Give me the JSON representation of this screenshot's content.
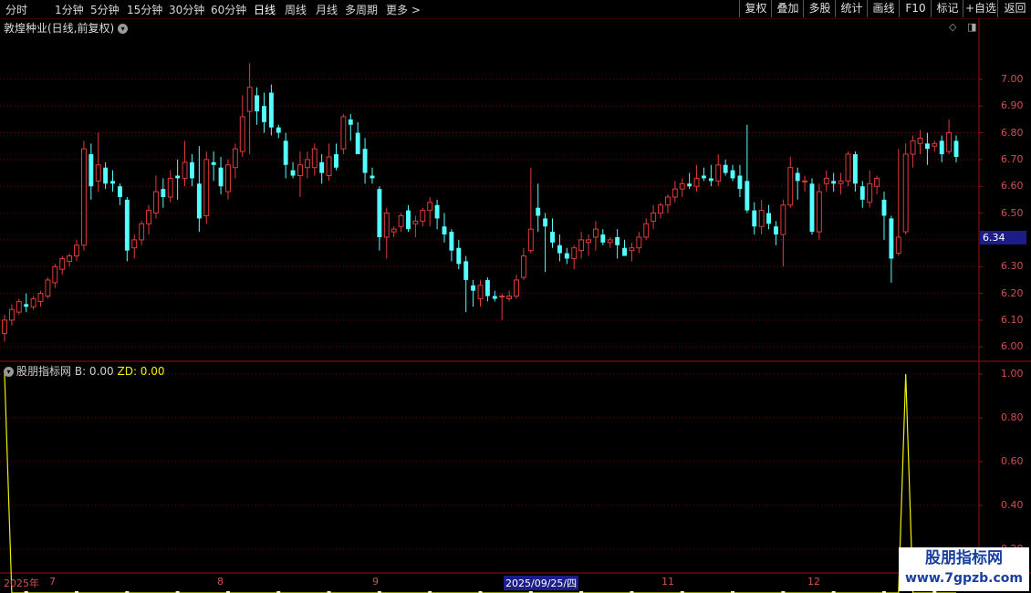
{
  "toolbar": {
    "periods": [
      "分时",
      "1分钟",
      "5分钟",
      "15分钟",
      "30分钟",
      "60分钟",
      "日线",
      "周线",
      "月线",
      "多周期",
      "更多 >"
    ],
    "active": "日线",
    "right_buttons": [
      "复权",
      "叠加",
      "多股",
      "统计",
      "画线",
      "F10",
      "标记",
      "+自选",
      "返回"
    ]
  },
  "main": {
    "title": "敦煌种业(日线,前复权)",
    "current_price": "6.34",
    "y_ticks": [
      "7.00",
      "6.90",
      "6.80",
      "6.70",
      "6.60",
      "6.50",
      "6.40",
      "6.30",
      "6.20",
      "6.10",
      "6.00"
    ]
  },
  "indicator": {
    "name": "股朋指标网",
    "b_label": "B: 0.00",
    "zd_label": "ZD: 0.00",
    "y_ticks": [
      "1.00",
      "0.80",
      "0.60",
      "0.40",
      "0.20"
    ]
  },
  "dates": {
    "labels": [
      "2025年",
      "7",
      "8",
      "9",
      "2025/09/25/四",
      "11",
      "12"
    ],
    "highlight": "2025/09/25/四"
  },
  "watermark": {
    "line1": "股朋指标网",
    "line2": "www.7gpzb.com"
  },
  "colors": {
    "up": "#e03b3b",
    "down": "#54ffff",
    "grid": "#8a0000",
    "zd_line": "#f0f000"
  },
  "chart_data": {
    "type": "candlestick",
    "ylim": [
      5.96,
      7.17
    ],
    "candles": [
      [
        6.05,
        6.12,
        6.02,
        6.1
      ],
      [
        6.1,
        6.16,
        6.08,
        6.14
      ],
      [
        6.13,
        6.18,
        6.12,
        6.17
      ],
      [
        6.16,
        6.2,
        6.13,
        6.15
      ],
      [
        6.15,
        6.19,
        6.14,
        6.18
      ],
      [
        6.17,
        6.21,
        6.15,
        6.2
      ],
      [
        6.19,
        6.26,
        6.18,
        6.25
      ],
      [
        6.24,
        6.31,
        6.22,
        6.3
      ],
      [
        6.29,
        6.34,
        6.27,
        6.33
      ],
      [
        6.32,
        6.35,
        6.3,
        6.34
      ],
      [
        6.34,
        6.4,
        6.32,
        6.38
      ],
      [
        6.38,
        6.77,
        6.36,
        6.74
      ],
      [
        6.72,
        6.76,
        6.55,
        6.6
      ],
      [
        6.62,
        6.8,
        6.58,
        6.68
      ],
      [
        6.67,
        6.69,
        6.59,
        6.61
      ],
      [
        6.62,
        6.66,
        6.58,
        6.61
      ],
      [
        6.6,
        6.61,
        6.53,
        6.56
      ],
      [
        6.55,
        6.56,
        6.32,
        6.36
      ],
      [
        6.37,
        6.42,
        6.33,
        6.4
      ],
      [
        6.4,
        6.47,
        6.38,
        6.46
      ],
      [
        6.46,
        6.53,
        6.42,
        6.51
      ],
      [
        6.5,
        6.64,
        6.48,
        6.58
      ],
      [
        6.59,
        6.63,
        6.52,
        6.56
      ],
      [
        6.56,
        6.66,
        6.54,
        6.63
      ],
      [
        6.64,
        6.7,
        6.55,
        6.63
      ],
      [
        6.63,
        6.77,
        6.6,
        6.69
      ],
      [
        6.69,
        6.72,
        6.6,
        6.63
      ],
      [
        6.61,
        6.75,
        6.43,
        6.48
      ],
      [
        6.49,
        6.73,
        6.46,
        6.7
      ],
      [
        6.69,
        6.73,
        6.62,
        6.68
      ],
      [
        6.67,
        6.71,
        6.57,
        6.6
      ],
      [
        6.58,
        6.7,
        6.55,
        6.68
      ],
      [
        6.67,
        6.76,
        6.63,
        6.74
      ],
      [
        6.73,
        6.94,
        6.71,
        6.86
      ],
      [
        6.88,
        7.06,
        6.72,
        6.97
      ],
      [
        6.94,
        6.97,
        6.83,
        6.88
      ],
      [
        6.9,
        6.95,
        6.8,
        6.84
      ],
      [
        6.95,
        6.98,
        6.79,
        6.82
      ],
      [
        6.82,
        6.83,
        6.78,
        6.8
      ],
      [
        6.77,
        6.8,
        6.63,
        6.68
      ],
      [
        6.66,
        6.69,
        6.63,
        6.64
      ],
      [
        6.64,
        6.73,
        6.56,
        6.68
      ],
      [
        6.67,
        6.73,
        6.63,
        6.7
      ],
      [
        6.67,
        6.76,
        6.64,
        6.74
      ],
      [
        6.69,
        6.72,
        6.61,
        6.65
      ],
      [
        6.64,
        6.76,
        6.62,
        6.71
      ],
      [
        6.72,
        6.76,
        6.66,
        6.67
      ],
      [
        6.74,
        6.87,
        6.72,
        6.86
      ],
      [
        6.85,
        6.87,
        6.77,
        6.83
      ],
      [
        6.8,
        6.84,
        6.74,
        6.72
      ],
      [
        6.74,
        6.78,
        6.61,
        6.65
      ],
      [
        6.64,
        6.67,
        6.61,
        6.63
      ],
      [
        6.59,
        6.6,
        6.36,
        6.41
      ],
      [
        6.41,
        6.52,
        6.33,
        6.5
      ],
      [
        6.43,
        6.45,
        6.41,
        6.44
      ],
      [
        6.45,
        6.5,
        6.43,
        6.49
      ],
      [
        6.51,
        6.53,
        6.43,
        6.44
      ],
      [
        6.46,
        6.49,
        6.41,
        6.47
      ],
      [
        6.47,
        6.52,
        6.45,
        6.51
      ],
      [
        6.51,
        6.56,
        6.45,
        6.54
      ],
      [
        6.53,
        6.55,
        6.44,
        6.48
      ],
      [
        6.45,
        6.5,
        6.39,
        6.42
      ],
      [
        6.43,
        6.44,
        6.32,
        6.36
      ],
      [
        6.37,
        6.4,
        6.29,
        6.31
      ],
      [
        6.32,
        6.34,
        6.13,
        6.25
      ],
      [
        6.23,
        6.25,
        6.15,
        6.21
      ],
      [
        6.18,
        6.25,
        6.15,
        6.23
      ],
      [
        6.25,
        6.26,
        6.17,
        6.19
      ],
      [
        6.19,
        6.21,
        6.17,
        6.18
      ],
      [
        6.19,
        6.2,
        6.1,
        6.19
      ],
      [
        6.18,
        6.21,
        6.17,
        6.19
      ],
      [
        6.19,
        6.27,
        6.18,
        6.25
      ],
      [
        6.26,
        6.37,
        6.25,
        6.34
      ],
      [
        6.36,
        6.67,
        6.35,
        6.44
      ],
      [
        6.52,
        6.61,
        6.43,
        6.49
      ],
      [
        6.48,
        6.5,
        6.28,
        6.45
      ],
      [
        6.43,
        6.48,
        6.37,
        6.39
      ],
      [
        6.38,
        6.42,
        6.32,
        6.35
      ],
      [
        6.35,
        6.37,
        6.31,
        6.33
      ],
      [
        6.33,
        6.38,
        6.29,
        6.37
      ],
      [
        6.36,
        6.43,
        6.33,
        6.4
      ],
      [
        6.39,
        6.42,
        6.34,
        6.4
      ],
      [
        6.41,
        6.47,
        6.36,
        6.44
      ],
      [
        6.42,
        6.44,
        6.38,
        6.39
      ],
      [
        6.39,
        6.41,
        6.37,
        6.4
      ],
      [
        6.41,
        6.44,
        6.33,
        6.38
      ],
      [
        6.37,
        6.4,
        6.34,
        6.34
      ],
      [
        6.36,
        6.39,
        6.32,
        6.37
      ],
      [
        6.37,
        6.43,
        6.35,
        6.41
      ],
      [
        6.41,
        6.48,
        6.4,
        6.46
      ],
      [
        6.47,
        6.53,
        6.44,
        6.5
      ],
      [
        6.5,
        6.54,
        6.48,
        6.53
      ],
      [
        6.53,
        6.57,
        6.5,
        6.56
      ],
      [
        6.56,
        6.62,
        6.54,
        6.59
      ],
      [
        6.59,
        6.63,
        6.56,
        6.61
      ],
      [
        6.61,
        6.65,
        6.59,
        6.6
      ],
      [
        6.6,
        6.68,
        6.58,
        6.63
      ],
      [
        6.64,
        6.67,
        6.62,
        6.63
      ],
      [
        6.63,
        6.68,
        6.6,
        6.62
      ],
      [
        6.62,
        6.72,
        6.6,
        6.68
      ],
      [
        6.68,
        6.7,
        6.64,
        6.65
      ],
      [
        6.66,
        6.68,
        6.62,
        6.63
      ],
      [
        6.64,
        6.68,
        6.56,
        6.59
      ],
      [
        6.62,
        6.83,
        6.5,
        6.51
      ],
      [
        6.51,
        6.54,
        6.42,
        6.45
      ],
      [
        6.45,
        6.55,
        6.42,
        6.51
      ],
      [
        6.5,
        6.53,
        6.44,
        6.46
      ],
      [
        6.45,
        6.47,
        6.38,
        6.42
      ],
      [
        6.42,
        6.55,
        6.3,
        6.53
      ],
      [
        6.53,
        6.71,
        6.52,
        6.67
      ],
      [
        6.65,
        6.67,
        6.55,
        6.62
      ],
      [
        6.62,
        6.64,
        6.58,
        6.62
      ],
      [
        6.61,
        6.63,
        6.42,
        6.43
      ],
      [
        6.43,
        6.61,
        6.4,
        6.58
      ],
      [
        6.61,
        6.66,
        6.58,
        6.63
      ],
      [
        6.62,
        6.65,
        6.58,
        6.61
      ],
      [
        6.61,
        6.65,
        6.57,
        6.62
      ],
      [
        6.62,
        6.73,
        6.6,
        6.72
      ],
      [
        6.72,
        6.73,
        6.58,
        6.61
      ],
      [
        6.6,
        6.62,
        6.52,
        6.55
      ],
      [
        6.54,
        6.66,
        6.52,
        6.61
      ],
      [
        6.6,
        6.64,
        6.57,
        6.63
      ],
      [
        6.55,
        6.58,
        6.4,
        6.49
      ],
      [
        6.48,
        6.49,
        6.24,
        6.33
      ],
      [
        6.35,
        6.74,
        6.34,
        6.41
      ],
      [
        6.43,
        6.76,
        6.42,
        6.72
      ],
      [
        6.72,
        6.79,
        6.67,
        6.77
      ],
      [
        6.76,
        6.81,
        6.72,
        6.78
      ],
      [
        6.76,
        6.8,
        6.68,
        6.74
      ],
      [
        6.75,
        6.77,
        6.73,
        6.76
      ],
      [
        6.77,
        6.79,
        6.69,
        6.72
      ],
      [
        6.73,
        6.85,
        6.72,
        6.8
      ],
      [
        6.77,
        6.79,
        6.69,
        6.71
      ]
    ],
    "indicator_zd": {
      "nonzero": [
        [
          0,
          1.0
        ],
        [
          125,
          1.0
        ]
      ],
      "other": 0.0,
      "ylim": [
        0.1,
        1.05
      ]
    }
  }
}
